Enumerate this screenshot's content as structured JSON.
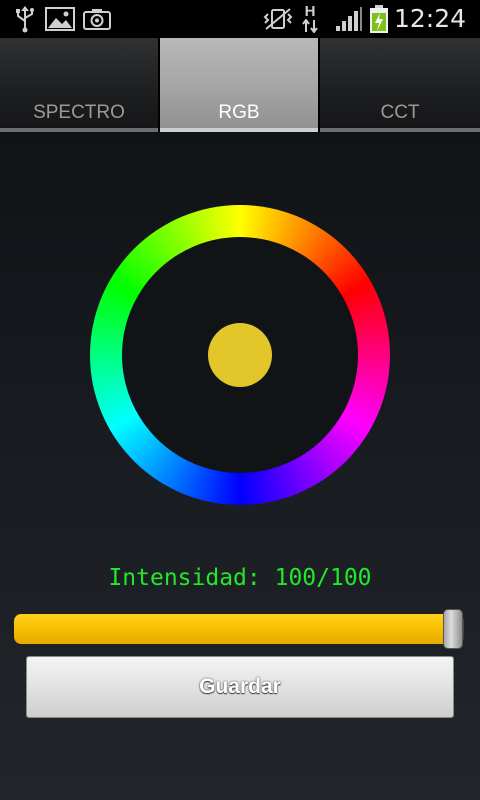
{
  "status_bar": {
    "time": "12:24",
    "network_type": "H",
    "icons": [
      "usb-icon",
      "gallery-icon",
      "camera-icon",
      "vibrate-mute-icon",
      "data-arrows-icon",
      "signal-icon",
      "battery-charging-icon"
    ]
  },
  "tabs": [
    {
      "label": "SPECTRO",
      "active": false
    },
    {
      "label": "RGB",
      "active": true
    },
    {
      "label": "CCT",
      "active": false
    }
  ],
  "color_picker": {
    "selected_color": "#e3c62a"
  },
  "intensity": {
    "label": "Intensidad: 100/100",
    "value": 100,
    "max": 100
  },
  "save_button": {
    "label": "Guardar"
  },
  "colors": {
    "accent_green": "#22e82a",
    "slider_yellow": "#f7bf00"
  }
}
